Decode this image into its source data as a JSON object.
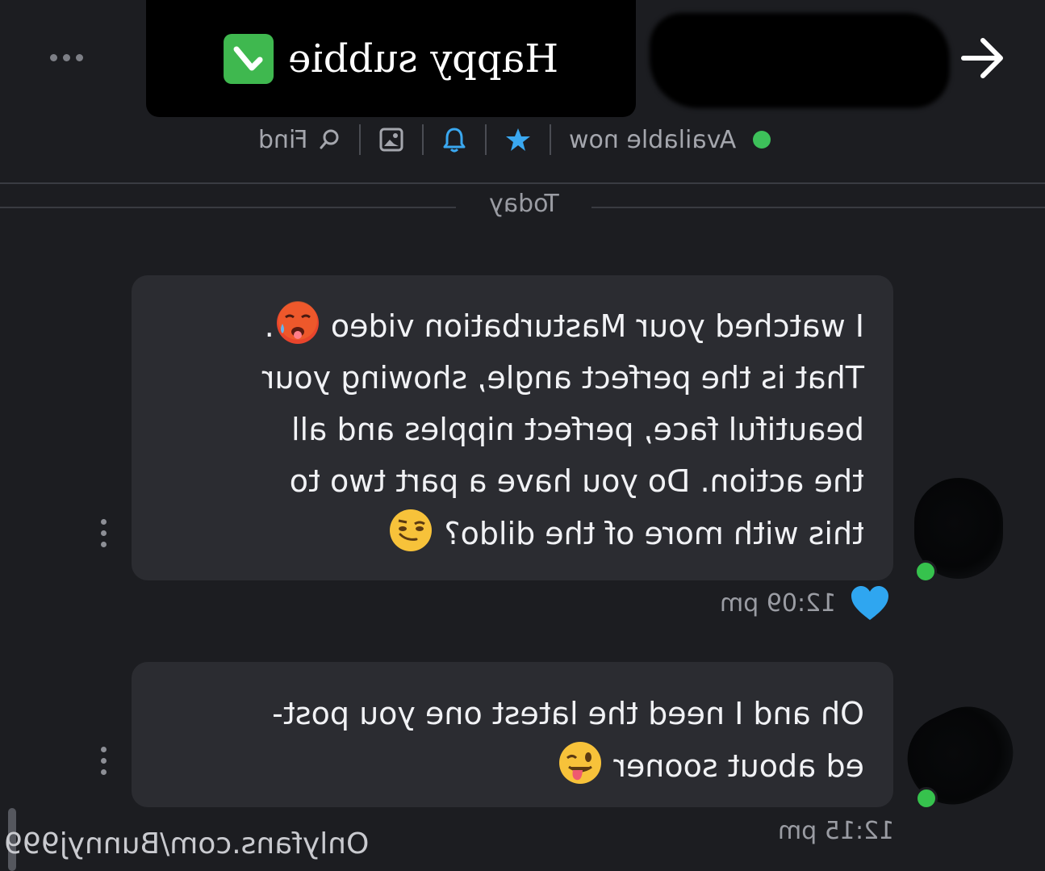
{
  "header": {
    "title": "Happy subbie",
    "title_emoji": "check-mark-button",
    "more_icon": "more-horizontal-icon",
    "forward_icon": "arrow-right-icon"
  },
  "toolbar": {
    "status": "Available now",
    "find_label": "Find",
    "items": [
      "star-icon",
      "bell-icon",
      "image-icon",
      "search-icon"
    ],
    "accent_color": "#3aa8f0",
    "status_color": "#3dc05a"
  },
  "chat": {
    "day_label": "Today",
    "messages": [
      {
        "lines": [
          "I watched your Masturbation video",
          "That is the perfect angle, showing your",
          "beautiful face, perfect nipples and all",
          "the action. Do you have a part two to",
          "this with more of the dildo?"
        ],
        "trailing_punct": ".",
        "emojis": [
          "hot-face",
          "smirking-face"
        ],
        "time": "12:09 pm",
        "liked": true
      },
      {
        "lines": [
          "Oh and I need the latest one you post-",
          "ed about sooner"
        ],
        "emojis": [
          "winking-face-with-tongue"
        ],
        "time": "12:15 pm",
        "liked": false
      }
    ]
  },
  "watermark": "Onlyfans.com/Bunnyj999"
}
